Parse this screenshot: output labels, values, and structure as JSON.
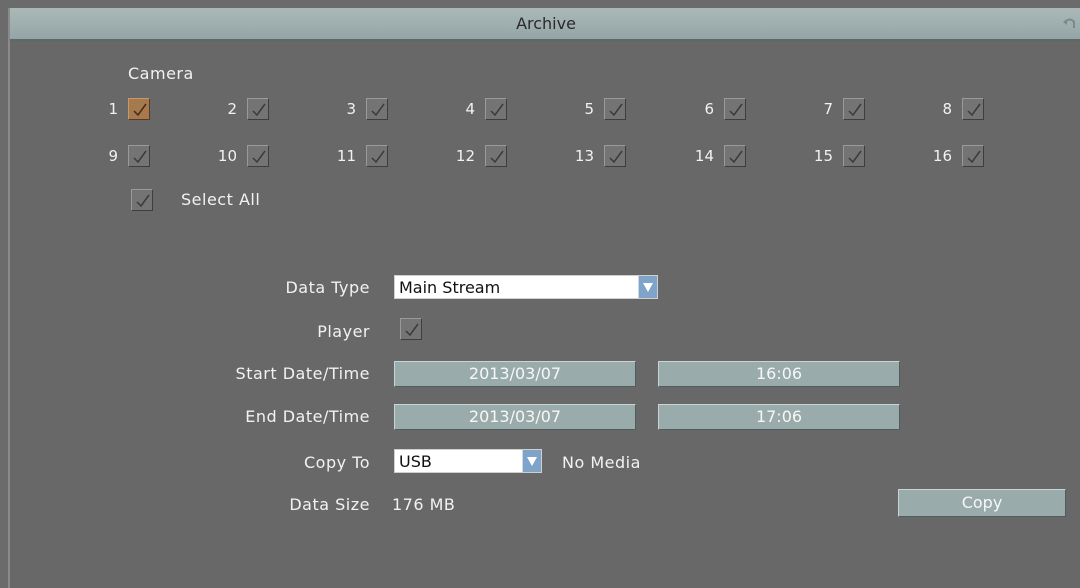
{
  "window": {
    "title": "Archive"
  },
  "camera": {
    "section_label": "Camera",
    "cameras": [
      {
        "num": "1",
        "checked": true,
        "focused": true
      },
      {
        "num": "2",
        "checked": true
      },
      {
        "num": "3",
        "checked": true
      },
      {
        "num": "4",
        "checked": true
      },
      {
        "num": "5",
        "checked": true
      },
      {
        "num": "6",
        "checked": true
      },
      {
        "num": "7",
        "checked": true
      },
      {
        "num": "8",
        "checked": true
      },
      {
        "num": "9",
        "checked": true
      },
      {
        "num": "10",
        "checked": true
      },
      {
        "num": "11",
        "checked": true
      },
      {
        "num": "12",
        "checked": true
      },
      {
        "num": "13",
        "checked": true
      },
      {
        "num": "14",
        "checked": true
      },
      {
        "num": "15",
        "checked": true
      },
      {
        "num": "16",
        "checked": true
      }
    ],
    "select_all_label": "Select All",
    "select_all_checked": true
  },
  "form": {
    "data_type_label": "Data Type",
    "data_type_value": "Main Stream",
    "player_label": "Player",
    "player_checked": true,
    "start_label": "Start Date/Time",
    "start_date": "2013/03/07",
    "start_time": "16:06",
    "end_label": "End Date/Time",
    "end_date": "2013/03/07",
    "end_time": "17:06",
    "copy_to_label": "Copy To",
    "copy_to_value": "USB",
    "media_status": "No Media",
    "data_size_label": "Data Size",
    "data_size_value": "176 MB",
    "copy_button": "Copy"
  },
  "colors": {
    "background": "#686868",
    "titlebar": "#a3b3b3",
    "field": "#9aabab",
    "focus": "#a57a4e",
    "dropdown_arrow": "#7fa3c9"
  },
  "icons": {
    "back": "return-arrow-icon",
    "check": "checkmark-icon",
    "dropdown": "triangle-down-icon"
  }
}
